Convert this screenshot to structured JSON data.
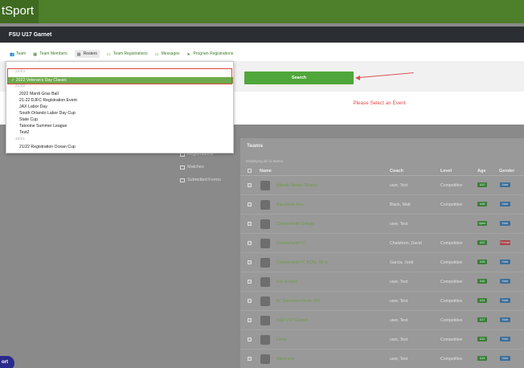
{
  "header": {
    "brand": "tSport"
  },
  "modal": {
    "title": "FSU U17 Garnet",
    "tabs": [
      {
        "label": "Team",
        "icon": "team-icon"
      },
      {
        "label": "Team Members",
        "icon": "members-icon"
      },
      {
        "label": "Rosters",
        "icon": "rosters-icon"
      },
      {
        "label": "Team Registrations",
        "icon": "registrations-icon"
      },
      {
        "label": "Messages",
        "icon": "messages-icon"
      },
      {
        "label": "Program Registrations",
        "icon": "send-icon"
      }
    ],
    "search_label": "Search",
    "select_message": "Please Select an Event"
  },
  "dropdown": {
    "group_2223": "22/23",
    "selected": "✓  2022 Veteran's Day Classic",
    "group_2122": "21/22",
    "items_2122": [
      "2022 Mardi Gras Ball",
      "21-22 DJFC Registration Event",
      "JAX Labor Day",
      "South Orlando Labor Day Cup",
      "State Cup",
      "Tatooine Summer League",
      "Test2"
    ],
    "group_2021": "20/21",
    "items_2021": [
      "21/22 Registration Ocean Cup"
    ]
  },
  "left_nav": [
    {
      "label": "Registrations"
    },
    {
      "label": "Matches"
    },
    {
      "label": "Submitted Forms"
    }
  ],
  "teams": {
    "title": "Teams",
    "count": "Displaying all 11 teams",
    "columns": [
      "Name",
      "Coach",
      "Level",
      "Age",
      "Gender"
    ],
    "rows": [
      {
        "name": "Atlantic Beach Sharks",
        "coach": "user, Test",
        "level": "Competitive",
        "age": "U12",
        "gender": "Male"
      },
      {
        "name": "Barcelona Fire",
        "coach": "Black, Matt",
        "level": "Competitive",
        "age": "U16",
        "gender": "Male"
      },
      {
        "name": "Chesterfield College",
        "coach": "user, Test",
        "level": "",
        "age": "Open",
        "gender": "Male"
      },
      {
        "name": "Chesterfield FC",
        "coach": "Chalstrom, David",
        "level": "Competitive",
        "age": "U12",
        "gender": "Female"
      },
      {
        "name": "Chesterfield FC ECNL 08 m",
        "coach": "Garcia, Jordi",
        "level": "Competitive",
        "age": "U15",
        "gender": "Male"
      },
      {
        "name": "Evil Empire",
        "coach": "user, Test",
        "level": "Competitive",
        "age": "U16",
        "gender": "Male"
      },
      {
        "name": "FC Evolution North 009",
        "coach": "user, Test",
        "level": "Competitive",
        "age": "U14",
        "gender": "Male"
      },
      {
        "name": "FSU U17 Garnet",
        "coach": "user, Test",
        "level": "Competitive",
        "age": "U17",
        "gender": "Male"
      },
      {
        "name": "Lions",
        "coach": "user, Test",
        "level": "Competitive",
        "age": "U12",
        "gender": "Male"
      },
      {
        "name": "Steamers",
        "coach": "user, Test",
        "level": "Competitive",
        "age": "U13",
        "gender": "Male"
      }
    ]
  },
  "fab_label": "ort",
  "colors": {
    "accent": "#4fa63a",
    "header": "#2b2f33",
    "brand_bar": "#4e7f2a",
    "warning": "#e14b4b"
  }
}
